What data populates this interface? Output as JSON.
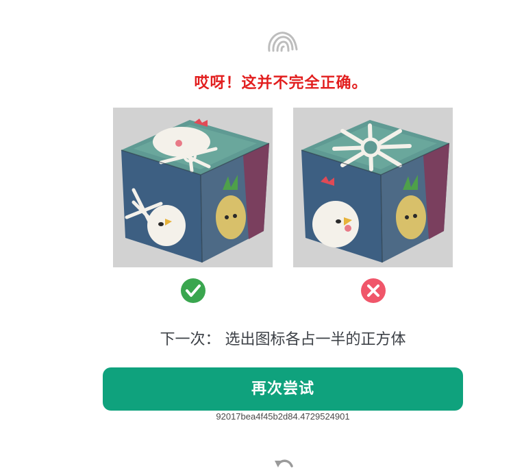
{
  "header": {
    "logo_icon": "brand-logo-icon",
    "title": "哎呀！这并不完全正确。",
    "title_color": "#e21e1e"
  },
  "options": [
    {
      "name": "cube-option-left",
      "status": "correct",
      "status_icon": "check-circle-icon",
      "status_color": "#3aa64f"
    },
    {
      "name": "cube-option-right",
      "status": "incorrect",
      "status_icon": "x-circle-icon",
      "status_color": "#f0566a"
    }
  ],
  "hint": {
    "text": "下一次： 选出图标各占一半的正方体"
  },
  "retry_button": {
    "label": "再次尝试",
    "color": "#0fa27d"
  },
  "session": {
    "id": "92017bea4f45b2d84.4729524901"
  },
  "footer": {
    "undo_icon": "undo-arrow-icon"
  }
}
